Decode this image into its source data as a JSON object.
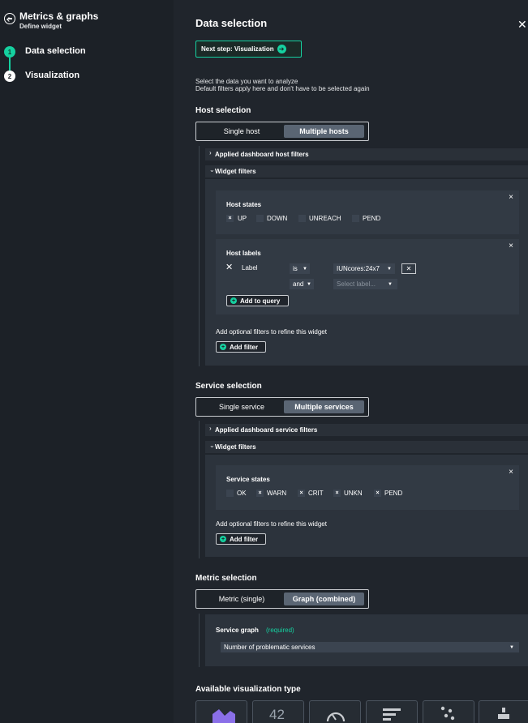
{
  "sidebar": {
    "title": "Metrics & graphs",
    "subtitle": "Define widget",
    "steps": [
      {
        "num": "1",
        "label": "Data selection"
      },
      {
        "num": "2",
        "label": "Visualization"
      }
    ]
  },
  "main": {
    "title": "Data selection",
    "next_button": "Next step: Visualization",
    "desc_line1": "Select the data you want to analyze",
    "desc_line2": "Default filters apply here and don't have to be selected again",
    "host": {
      "heading": "Host selection",
      "toggle": [
        "Single host",
        "Multiple hosts"
      ],
      "applied_filters": "Applied dashboard host filters",
      "widget_filters": "Widget filters",
      "states_title": "Host states",
      "states": [
        {
          "label": "UP",
          "checked": true
        },
        {
          "label": "DOWN",
          "checked": false
        },
        {
          "label": "UNREACH",
          "checked": false
        },
        {
          "label": "PEND",
          "checked": false
        }
      ],
      "labels_title": "Host labels",
      "label_field": "Label",
      "operator": "is",
      "label_value": "IUNcores:24x7",
      "conjunction": "and",
      "select_placeholder": "Select label...",
      "add_to_query": "Add to query",
      "optional_text": "Add optional filters to refine this widget",
      "add_filter": "Add filter"
    },
    "service": {
      "heading": "Service selection",
      "toggle": [
        "Single service",
        "Multiple services"
      ],
      "applied_filters": "Applied dashboard service filters",
      "widget_filters": "Widget filters",
      "states_title": "Service states",
      "states": [
        {
          "label": "OK",
          "checked": false
        },
        {
          "label": "WARN",
          "checked": true
        },
        {
          "label": "CRIT",
          "checked": true
        },
        {
          "label": "UNKN",
          "checked": true
        },
        {
          "label": "PEND",
          "checked": true
        }
      ],
      "optional_text": "Add optional filters to refine this widget",
      "add_filter": "Add filter"
    },
    "metric": {
      "heading": "Metric selection",
      "toggle": [
        "Metric (single)",
        "Graph (combined)"
      ],
      "graph_label": "Service graph",
      "required": "(required)",
      "graph_value": "Number of problematic services"
    },
    "visualization": {
      "heading": "Available visualization type",
      "tile_number": "42"
    }
  },
  "colors": {
    "accent": "#15d1a0",
    "background": "#20252c",
    "sidebar": "#1c2127"
  }
}
